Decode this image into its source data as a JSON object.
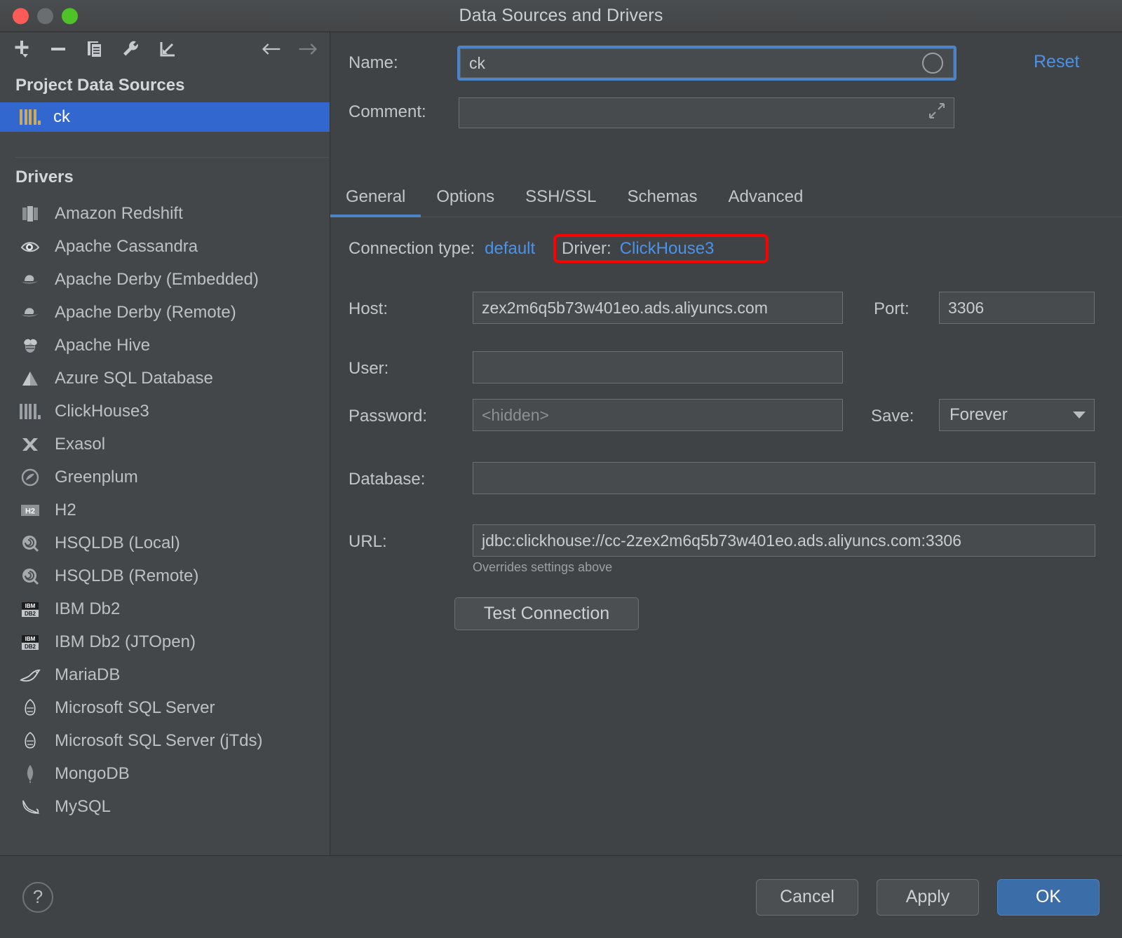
{
  "window": {
    "title": "Data Sources and Drivers",
    "controls": [
      "close",
      "minimize",
      "zoom"
    ]
  },
  "left_toolbar": {
    "buttons": [
      {
        "name": "add-data-source-button",
        "icon": "plus-dropdown-icon",
        "label": "Add"
      },
      {
        "name": "remove-data-source-button",
        "icon": "minus-icon",
        "label": "Remove"
      },
      {
        "name": "duplicate-data-source-button",
        "icon": "copy-icon",
        "label": "Duplicate"
      },
      {
        "name": "properties-button",
        "icon": "wrench-icon",
        "label": "Properties"
      },
      {
        "name": "import-button",
        "icon": "import-arrow-icon",
        "label": "Import"
      },
      {
        "name": "back-button",
        "icon": "arrow-left-icon",
        "label": "Back"
      },
      {
        "name": "forward-button",
        "icon": "arrow-right-icon",
        "label": "Forward"
      }
    ]
  },
  "sidebar": {
    "project_section_title": "Project Data Sources",
    "data_sources": [
      {
        "label": "ck",
        "icon": "clickhouse-icon",
        "selected": true
      }
    ],
    "drivers_section_title": "Drivers",
    "drivers": [
      {
        "label": "Amazon Redshift",
        "icon": "redshift-icon"
      },
      {
        "label": "Apache Cassandra",
        "icon": "cassandra-eye-icon"
      },
      {
        "label": "Apache Derby (Embedded)",
        "icon": "derby-hat-icon"
      },
      {
        "label": "Apache Derby (Remote)",
        "icon": "derby-hat-icon"
      },
      {
        "label": "Apache Hive",
        "icon": "hive-bee-icon"
      },
      {
        "label": "Azure SQL Database",
        "icon": "azure-icon"
      },
      {
        "label": "ClickHouse3",
        "icon": "clickhouse-icon"
      },
      {
        "label": "Exasol",
        "icon": "exasol-x-icon"
      },
      {
        "label": "Greenplum",
        "icon": "greenplum-icon"
      },
      {
        "label": "H2",
        "icon": "h2-icon"
      },
      {
        "label": "HSQLDB (Local)",
        "icon": "hsqldb-icon"
      },
      {
        "label": "HSQLDB (Remote)",
        "icon": "hsqldb-icon"
      },
      {
        "label": "IBM Db2",
        "icon": "ibm-db2-icon"
      },
      {
        "label": "IBM Db2 (JTOpen)",
        "icon": "ibm-db2-icon"
      },
      {
        "label": "MariaDB",
        "icon": "mariadb-seal-icon"
      },
      {
        "label": "Microsoft SQL Server",
        "icon": "mssql-icon"
      },
      {
        "label": "Microsoft SQL Server (jTds)",
        "icon": "mssql-icon"
      },
      {
        "label": "MongoDB",
        "icon": "mongodb-leaf-icon"
      },
      {
        "label": "MySQL",
        "icon": "mysql-dolphin-icon"
      }
    ]
  },
  "form": {
    "name_label": "Name:",
    "name_value": "ck",
    "name_color_button": "color-circle-icon",
    "comment_label": "Comment:",
    "comment_value": "",
    "comment_placeholder": "",
    "comment_expand_button": "expand-icon",
    "reset_label": "Reset"
  },
  "tabs": [
    {
      "label": "General",
      "active": true
    },
    {
      "label": "Options",
      "active": false
    },
    {
      "label": "SSH/SSL",
      "active": false
    },
    {
      "label": "Schemas",
      "active": false
    },
    {
      "label": "Advanced",
      "active": false
    }
  ],
  "general": {
    "connection_type_label": "Connection type:",
    "connection_type_value": "default",
    "driver_label": "Driver:",
    "driver_value": "ClickHouse3",
    "host_label": "Host:",
    "host_value": "zex2m6q5b73w401eo.ads.aliyuncs.com",
    "port_label": "Port:",
    "port_value": "3306",
    "user_label": "User:",
    "user_value": "",
    "password_label": "Password:",
    "password_placeholder": "<hidden>",
    "save_label": "Save:",
    "save_value": "Forever",
    "database_label": "Database:",
    "database_value": "",
    "url_label": "URL:",
    "url_value": "jdbc:clickhouse://cc-2zex2m6q5b73w401eo.ads.aliyuncs.com:3306",
    "url_hint": "Overrides settings above",
    "test_connection_label": "Test Connection"
  },
  "annotation": {
    "target": "driver-field",
    "color": "#ff0000"
  },
  "footer": {
    "help_label": "?",
    "cancel_label": "Cancel",
    "apply_label": "Apply",
    "ok_label": "OK"
  },
  "colors": {
    "accent": "#4d84c8",
    "selection": "#3267cf",
    "link": "#4b92e8",
    "annotation": "#ff0000",
    "primary_button": "#3b6ea8"
  }
}
